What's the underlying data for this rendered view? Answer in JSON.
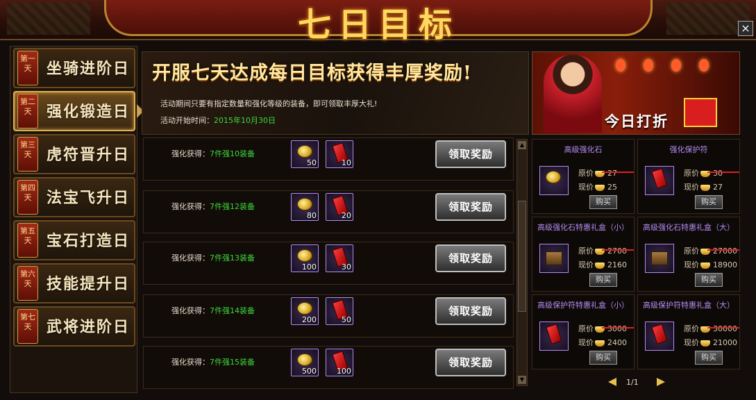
{
  "header": {
    "title": "七日目标",
    "close_label": "×"
  },
  "nav": {
    "items": [
      {
        "badge": "第一天",
        "label": "坐骑进阶日"
      },
      {
        "badge": "第二天",
        "label": "强化锻造日"
      },
      {
        "badge": "第三天",
        "label": "虎符晋升日"
      },
      {
        "badge": "第四天",
        "label": "法宝飞升日"
      },
      {
        "badge": "第五天",
        "label": "宝石打造日"
      },
      {
        "badge": "第六天",
        "label": "技能提升日"
      },
      {
        "badge": "第七天",
        "label": "武将进阶日"
      }
    ],
    "active_index": 1
  },
  "banner": {
    "headline": "开服七天达成每日目标获得丰厚奖励!",
    "desc": "活动期间只要有指定数量和强化等级的装备，即可领取丰厚大礼!",
    "date_label": "活动开始时间：",
    "date": "2015年10月30日"
  },
  "tasks": [
    {
      "label": "强化获得：",
      "cond": "7件强10装备",
      "stone": "50",
      "charm": "10",
      "button": "领取奖励"
    },
    {
      "label": "强化获得：",
      "cond": "7件强12装备",
      "stone": "80",
      "charm": "20",
      "button": "领取奖励"
    },
    {
      "label": "强化获得：",
      "cond": "7件强13装备",
      "stone": "100",
      "charm": "30",
      "button": "领取奖励"
    },
    {
      "label": "强化获得：",
      "cond": "7件强14装备",
      "stone": "200",
      "charm": "50",
      "button": "领取奖励"
    },
    {
      "label": "强化获得：",
      "cond": "7件强15装备",
      "stone": "500",
      "charm": "100",
      "button": "领取奖励"
    }
  ],
  "promo": {
    "label": "今日打折"
  },
  "shop": {
    "orig_label": "原价",
    "now_label": "现价",
    "buy_label": "购买",
    "items": [
      {
        "name": "高级强化石",
        "orig": "27",
        "now": "25",
        "icon": "coin"
      },
      {
        "name": "强化保护符",
        "orig": "30",
        "now": "27",
        "icon": "talisman"
      },
      {
        "name": "高级强化石特惠礼盒（小）",
        "orig": "2700",
        "now": "2160",
        "icon": "chest"
      },
      {
        "name": "高级强化石特惠礼盒（大）",
        "orig": "27000",
        "now": "18900",
        "icon": "chest"
      },
      {
        "name": "高级保护符特惠礼盒（小）",
        "orig": "3000",
        "now": "2400",
        "icon": "box"
      },
      {
        "name": "高级保护符特惠礼盒（大）",
        "orig": "30000",
        "now": "21000",
        "icon": "box"
      }
    ]
  },
  "pager": {
    "indicator": "1/1"
  },
  "colors": {
    "gold": "#ffd860",
    "green": "#3cd83c",
    "purple": "#b58cf0",
    "red": "#e02020"
  }
}
